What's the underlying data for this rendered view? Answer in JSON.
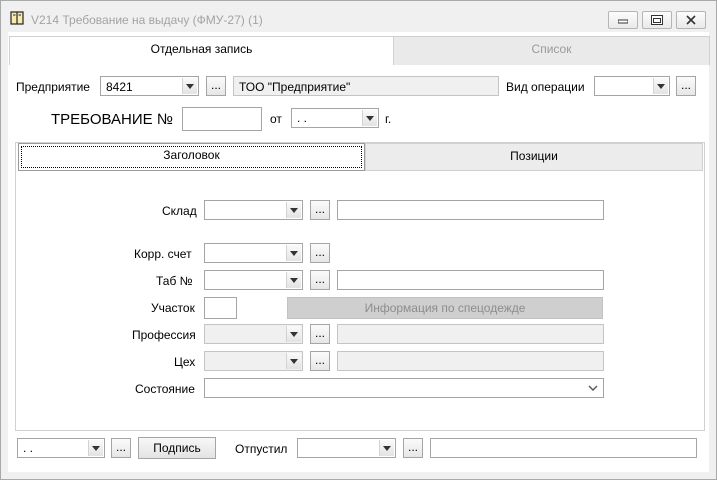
{
  "window": {
    "title": "V214 Требование на выдачу (ФМУ-27) (1)",
    "icon": "book-icon",
    "controls": [
      "minimize-icon",
      "maximize-icon",
      "close-icon"
    ]
  },
  "tabs": {
    "record": "Отдельная запись",
    "list": "Список"
  },
  "header": {
    "enterprise_label": "Предприятие",
    "enterprise_code": "8421",
    "enterprise_name": "ТОО  \"Предприятие\"",
    "operation_label": "Вид операции",
    "operation_value": "",
    "request_label": "ТРЕБОВАНИЕ №",
    "request_number": "",
    "from_label": "от",
    "date_value": " .  .",
    "year_suffix": "г."
  },
  "inner_tabs": {
    "heading": "Заголовок",
    "positions": "Позиции"
  },
  "form": {
    "warehouse_label": "Склад",
    "account_label": "Корр. счет",
    "tab_label": "Таб №",
    "site_label": "Участок",
    "workwear_button": "Информация по спецодежде",
    "profession_label": "Профессия",
    "shop_label": "Цех",
    "state_label": "Состояние"
  },
  "footer": {
    "date_value": " .  .",
    "sign_button": "Подпись",
    "released_label": "Отпустил"
  },
  "dots": "..."
}
